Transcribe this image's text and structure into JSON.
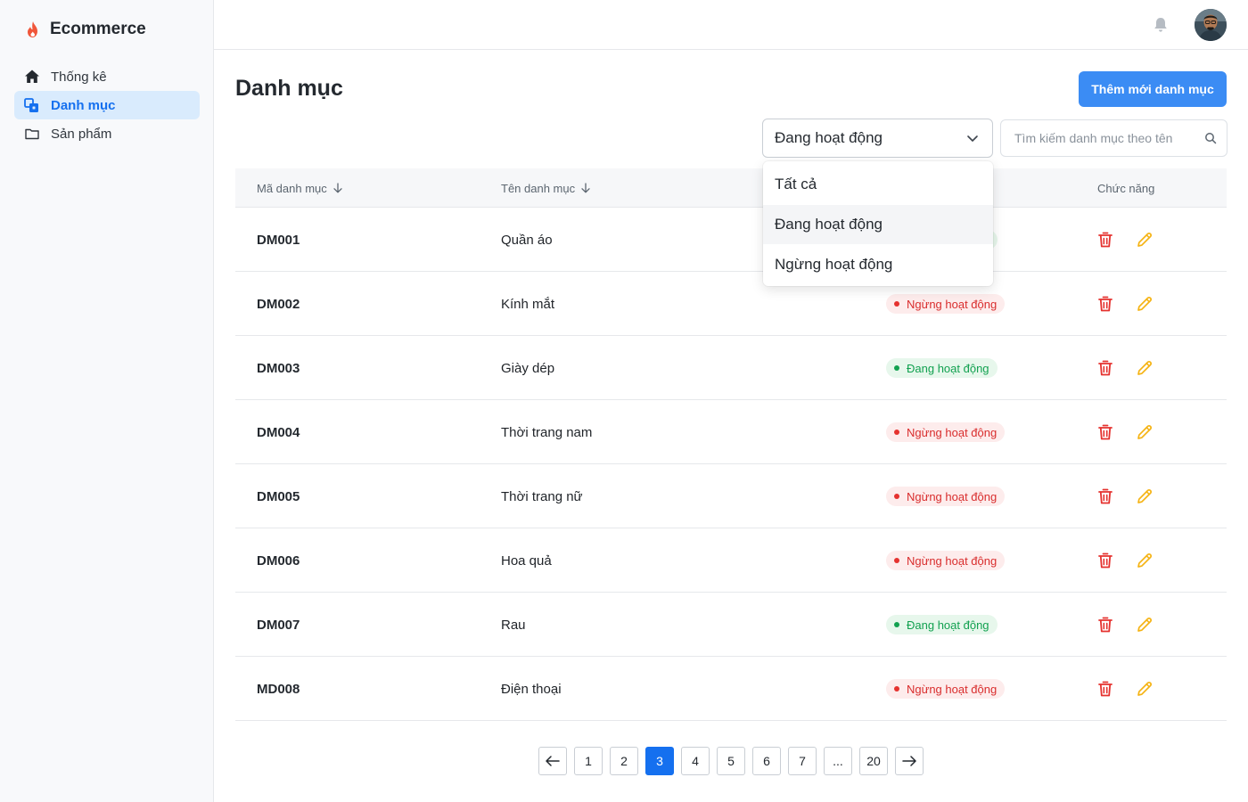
{
  "brand": {
    "name": "Ecommerce",
    "icon": "flame-icon",
    "icon_color": "#f0563a"
  },
  "sidebar": {
    "items": [
      {
        "label": "Thống kê",
        "icon": "home-icon"
      },
      {
        "label": "Danh mục",
        "icon": "category-icon",
        "active": true
      },
      {
        "label": "Sản phẩm",
        "icon": "folder-icon"
      }
    ]
  },
  "topbar": {
    "notification_icon": "bell-icon",
    "avatar": "user-avatar"
  },
  "page": {
    "title": "Danh mục",
    "add_button": "Thêm mới danh mục"
  },
  "filter": {
    "selected": "Đang hoạt động",
    "options": [
      "Tất cả",
      "Đang hoạt động",
      "Ngừng hoạt động"
    ],
    "hovered_index": 1
  },
  "search": {
    "placeholder": "Tìm kiếm danh mục theo tên",
    "value": ""
  },
  "table": {
    "headers": {
      "code": "Mã danh mục",
      "name": "Tên danh mục",
      "actions": "Chức năng"
    },
    "rows": [
      {
        "code": "DM001",
        "name": "Quần áo",
        "status": "Đang hoạt động",
        "status_type": "active"
      },
      {
        "code": "DM002",
        "name": "Kính mắt",
        "status": "Ngừng hoạt động",
        "status_type": "inactive"
      },
      {
        "code": "DM003",
        "name": "Giày dép",
        "status": "Đang hoạt động",
        "status_type": "active"
      },
      {
        "code": "DM004",
        "name": "Thời trang nam",
        "status": "Ngừng hoạt động",
        "status_type": "inactive"
      },
      {
        "code": "DM005",
        "name": "Thời trang nữ",
        "status": "Ngừng hoạt động",
        "status_type": "inactive"
      },
      {
        "code": "DM006",
        "name": "Hoa quả",
        "status": "Ngừng hoạt động",
        "status_type": "inactive"
      },
      {
        "code": "DM007",
        "name": "Rau",
        "status": "Đang hoạt động",
        "status_type": "active"
      },
      {
        "code": "MD008",
        "name": "Điện thoại",
        "status": "Ngừng hoạt động",
        "status_type": "inactive"
      }
    ]
  },
  "pagination": {
    "prev_icon": "arrow-left-icon",
    "next_icon": "arrow-right-icon",
    "pages": [
      "1",
      "2",
      "3",
      "4",
      "5",
      "6",
      "7",
      "...",
      "20"
    ],
    "current": "3"
  },
  "colors": {
    "primary": "#1570ef",
    "add_button": "#3b8cf4",
    "delete": "#e5322f",
    "edit": "#f5b313",
    "active": "#12a150",
    "inactive": "#d92d2d"
  }
}
